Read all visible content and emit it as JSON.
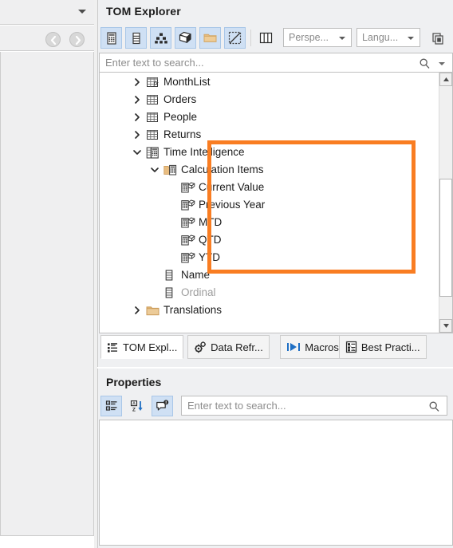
{
  "theme": {
    "highlight_color": "#f97d22",
    "panel_bg": "#eff0f2",
    "accent_blue": "#cfe0f4",
    "folder_tan": "#e8c389",
    "text": "#1b1b1b",
    "dim_text": "#9d9d9d"
  },
  "left_pane": {
    "dropdown_icon": "chevron-down-icon",
    "back_icon": "arrow-left-circle-icon",
    "forward_icon": "arrow-right-circle-icon"
  },
  "tom_explorer": {
    "title": "TOM Explorer",
    "window_buttons": [
      {
        "name": "float-window-button",
        "icon": "square-icon"
      },
      {
        "name": "pin-window-button",
        "icon": "pin-icon"
      },
      {
        "name": "close-window-button",
        "icon": "close-icon"
      }
    ],
    "toolbar": {
      "buttons": [
        {
          "name": "tables-toggle-button",
          "icon": "calculator-table-icon",
          "state": "active"
        },
        {
          "name": "columns-toggle-button",
          "icon": "column-list-icon",
          "state": "active"
        },
        {
          "name": "hierarchies-toggle-button",
          "icon": "hierarchy-icon",
          "state": "active"
        },
        {
          "name": "measures-toggle-button",
          "icon": "cube-icon",
          "state": "active"
        },
        {
          "name": "folders-toggle-button",
          "icon": "folder-icon",
          "state": "active"
        },
        {
          "name": "hidden-objects-toggle-button",
          "icon": "hidden-slash-icon",
          "state": "active"
        },
        {
          "name": "all-columns-button",
          "icon": "grid-columns-icon",
          "state": "plain"
        }
      ],
      "perspective_select": {
        "label": "Perspe...",
        "arrow": "chevron-down-icon"
      },
      "language_select": {
        "label": "Langu...",
        "arrow": "chevron-down-icon"
      },
      "copy_button": {
        "name": "copy-metadata-button",
        "icon": "copy-icon"
      }
    },
    "search": {
      "placeholder": "Enter text to search...",
      "value": "",
      "icon": "search-icon",
      "dropdown_icon": "chevron-down-icon"
    },
    "tree": [
      {
        "label": "MonthList",
        "indent": 1,
        "chevron": "collapsed",
        "icon": "calculated-table-icon",
        "dim": false
      },
      {
        "label": "Orders",
        "indent": 1,
        "chevron": "collapsed",
        "icon": "table-icon",
        "dim": false
      },
      {
        "label": "People",
        "indent": 1,
        "chevron": "collapsed",
        "icon": "table-icon",
        "dim": false
      },
      {
        "label": "Returns",
        "indent": 1,
        "chevron": "collapsed",
        "icon": "table-icon",
        "dim": false
      },
      {
        "label": "Time Intelligence",
        "indent": 1,
        "chevron": "expanded",
        "icon": "calculation-group-icon",
        "dim": false
      },
      {
        "label": "Calculation Items",
        "indent": 2,
        "chevron": "expanded",
        "icon": "calculation-items-folder-icon",
        "dim": false
      },
      {
        "label": "Current Value",
        "indent": 3,
        "chevron": "none",
        "icon": "calculation-item-icon",
        "dim": false
      },
      {
        "label": "Previous Year",
        "indent": 3,
        "chevron": "none",
        "icon": "calculation-item-icon",
        "dim": false
      },
      {
        "label": "MTD",
        "indent": 3,
        "chevron": "none",
        "icon": "calculation-item-icon",
        "dim": false
      },
      {
        "label": "QTD",
        "indent": 3,
        "chevron": "none",
        "icon": "calculation-item-icon",
        "dim": false
      },
      {
        "label": "YTD",
        "indent": 3,
        "chevron": "none",
        "icon": "calculation-item-icon",
        "dim": false
      },
      {
        "label": "Name",
        "indent": 2,
        "chevron": "none",
        "icon": "column-icon",
        "dim": false
      },
      {
        "label": "Ordinal",
        "indent": 2,
        "chevron": "none",
        "icon": "column-icon",
        "dim": true
      },
      {
        "label": "Translations",
        "indent": 1,
        "chevron": "collapsed",
        "icon": "folder-icon",
        "dim": false
      }
    ],
    "highlight": {
      "covers_from": "Time Intelligence",
      "covers_to": "YTD"
    },
    "scrollbar": {
      "up_icon": "triangle-up-icon",
      "down_icon": "triangle-down-icon"
    }
  },
  "document_tabs": [
    {
      "label": "TOM Expl...",
      "icon": "tree-list-icon",
      "selected": true
    },
    {
      "label": "Data Refr...",
      "icon": "gears-icon",
      "selected": false
    },
    {
      "label": "Macros",
      "icon": "play-bar-icon",
      "selected": false
    },
    {
      "label": "Best Practi...",
      "icon": "checklist-doc-icon",
      "selected": false
    }
  ],
  "properties": {
    "title": "Properties",
    "window_buttons": [
      {
        "name": "float-window-button",
        "icon": "square-icon"
      },
      {
        "name": "pin-window-button",
        "icon": "pin-icon"
      },
      {
        "name": "close-window-button",
        "icon": "close-icon"
      }
    ],
    "toolbar": [
      {
        "name": "categorized-view-button",
        "icon": "categorized-icon",
        "state": "active"
      },
      {
        "name": "alphabetical-sort-button",
        "icon": "sort-az-icon",
        "state": "plain"
      },
      {
        "name": "property-pages-button",
        "icon": "comment-badge-icon",
        "state": "active"
      }
    ],
    "search": {
      "placeholder": "Enter text to search...",
      "value": "",
      "icon": "search-icon"
    },
    "grid_rows": []
  }
}
